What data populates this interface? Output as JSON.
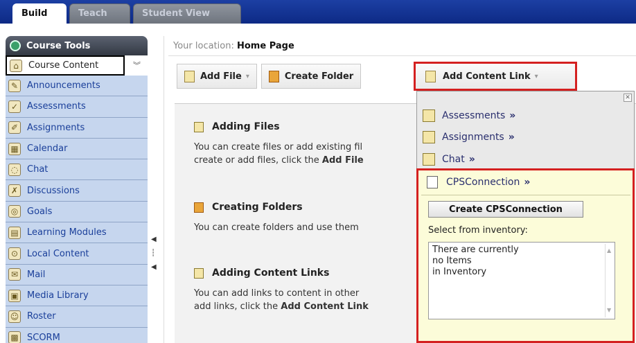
{
  "tabs": [
    {
      "label": "Build",
      "active": true
    },
    {
      "label": "Teach",
      "active": false
    },
    {
      "label": "Student View",
      "active": false
    }
  ],
  "sidebar": {
    "header": "Course Tools",
    "items": [
      {
        "label": "Course Content",
        "icon": "course-content-icon",
        "current": true
      },
      {
        "label": "Announcements",
        "icon": "announcements-icon"
      },
      {
        "label": "Assessments",
        "icon": "assessments-icon"
      },
      {
        "label": "Assignments",
        "icon": "assignments-icon"
      },
      {
        "label": "Calendar",
        "icon": "calendar-icon"
      },
      {
        "label": "Chat",
        "icon": "chat-icon"
      },
      {
        "label": "Discussions",
        "icon": "discussions-icon"
      },
      {
        "label": "Goals",
        "icon": "goals-icon"
      },
      {
        "label": "Learning Modules",
        "icon": "learning-modules-icon"
      },
      {
        "label": "Local Content",
        "icon": "local-content-icon"
      },
      {
        "label": "Mail",
        "icon": "mail-icon"
      },
      {
        "label": "Media Library",
        "icon": "media-library-icon"
      },
      {
        "label": "Roster",
        "icon": "roster-icon"
      },
      {
        "label": "SCORM",
        "icon": "scorm-icon"
      }
    ]
  },
  "breadcrumb": {
    "prefix": "Your location:",
    "current": "Home Page"
  },
  "toolbar": {
    "add_file": "Add File",
    "create_folder": "Create Folder",
    "add_content_link": "Add Content Link"
  },
  "sections": [
    {
      "title": "Adding Files",
      "line1": "You can create files or add existing fil",
      "line2_pre": "create or add files, click the ",
      "line2_bold": "Add File"
    },
    {
      "title": "Creating Folders",
      "line1": "You can create folders and use them"
    },
    {
      "title": "Adding Content Links",
      "line1": "You can add links to content in other",
      "line2_pre": "add links, click the ",
      "line2_bold": "Add Content Link"
    }
  ],
  "dropdown": {
    "items": [
      {
        "label": "Assessments",
        "icon": "assessments-icon"
      },
      {
        "label": "Assignments",
        "icon": "assignments-icon"
      },
      {
        "label": "Chat",
        "icon": "chat-icon"
      }
    ],
    "raquo": "»",
    "cps": {
      "title": "CPSConnection",
      "create_button": "Create CPSConnection",
      "inventory_label": "Select from inventory:",
      "inventory_lines": [
        "There are currently",
        "no Items",
        "in Inventory"
      ]
    }
  },
  "colors": {
    "topbar": "#0d2a85",
    "sidebar_item_bg": "#c6d6ee",
    "highlight": "#d42020",
    "cps_bg": "#fcfcd9"
  }
}
